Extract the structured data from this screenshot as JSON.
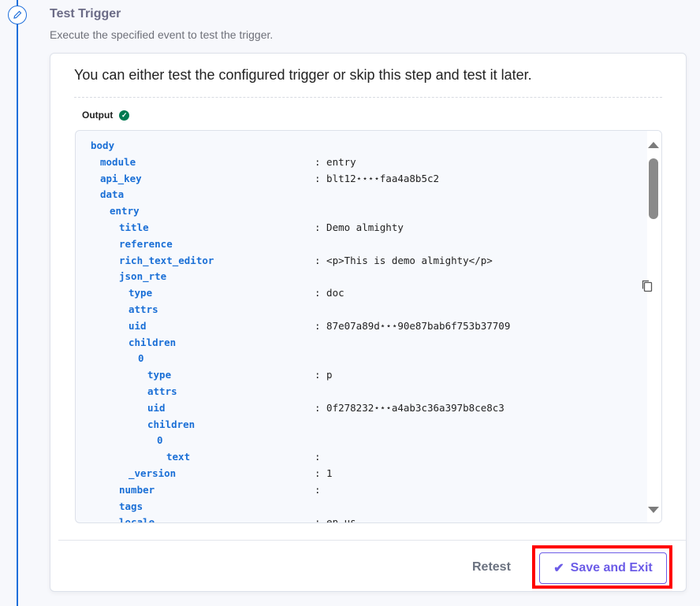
{
  "step": {
    "title": "Test Trigger",
    "subtitle": "Execute the specified event to test the trigger.",
    "icon": "pencil-icon"
  },
  "card": {
    "intro": "You can either test the configured trigger or skip this step and test it later.",
    "output_label": "Output",
    "status_icon": "check-circle-icon"
  },
  "output_rows": [
    {
      "key": "body",
      "level": 0,
      "value": ""
    },
    {
      "key": "module",
      "level": 1,
      "value": ": entry"
    },
    {
      "key": "api_key",
      "level": 1,
      "value": ": blt12⋆⋆⋆⋆faa4a8b5c2"
    },
    {
      "key": "data",
      "level": 1,
      "value": ""
    },
    {
      "key": "entry",
      "level": 2,
      "value": ""
    },
    {
      "key": "title",
      "level": 3,
      "value": ": Demo almighty"
    },
    {
      "key": "reference",
      "level": 3,
      "value": ""
    },
    {
      "key": "rich_text_editor",
      "level": 3,
      "value": ": <p>This is demo almighty</p>"
    },
    {
      "key": "json_rte",
      "level": 3,
      "value": ""
    },
    {
      "key": "type",
      "level": 4,
      "value": ": doc"
    },
    {
      "key": "attrs",
      "level": 4,
      "value": ""
    },
    {
      "key": "uid",
      "level": 4,
      "value": ": 87e07a89d⋆⋆⋆90e87bab6f753b37709"
    },
    {
      "key": "children",
      "level": 4,
      "value": ""
    },
    {
      "key": "0",
      "level": 5,
      "value": ""
    },
    {
      "key": "type",
      "level": 6,
      "value": ": p"
    },
    {
      "key": "attrs",
      "level": 6,
      "value": ""
    },
    {
      "key": "uid",
      "level": 6,
      "value": ": 0f278232⋆⋆⋆a4ab3c36a397b8ce8c3"
    },
    {
      "key": "children",
      "level": 6,
      "value": ""
    },
    {
      "key": "0",
      "level": 7,
      "value": ""
    },
    {
      "key": "text",
      "level": 8,
      "value": ":"
    },
    {
      "key": "_version",
      "level": 4,
      "value": ": 1"
    },
    {
      "key": "number",
      "level": 3,
      "value": ":"
    },
    {
      "key": "tags",
      "level": 3,
      "value": ""
    },
    {
      "key": "locale",
      "level": 3,
      "value": ": en-us"
    }
  ],
  "footer": {
    "retest_label": "Retest",
    "save_label": "Save and Exit"
  },
  "colors": {
    "accent": "#6c5ce7",
    "key": "#1a6fd6",
    "rail": "#1f6fdb",
    "success": "#007a52",
    "highlight": "#ff0000"
  }
}
